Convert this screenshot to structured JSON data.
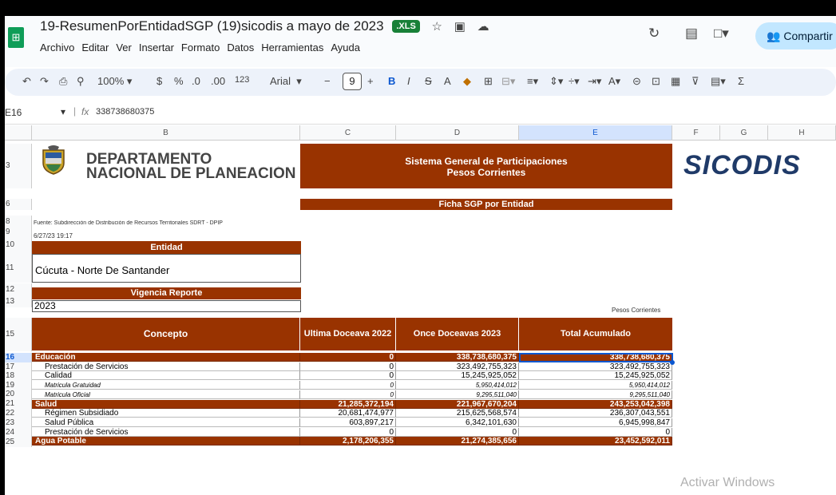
{
  "window": {
    "title": "19-ResumenPorEntidadSGP (19)sicodis a mayo de 2023",
    "badge": ".XLS",
    "share_label": "Compartir"
  },
  "menu": [
    "Archivo",
    "Editar",
    "Ver",
    "Insertar",
    "Formato",
    "Datos",
    "Herramientas",
    "Ayuda"
  ],
  "toolbar": {
    "zoom": "100%",
    "currency": "$",
    "percent": "%",
    "dec_minus": ".0",
    "dec_plus": ".00",
    "number_format": "123",
    "font": "Arial",
    "font_size": "9",
    "bold": "B",
    "italic": "I",
    "strike": "S",
    "text_color": "A",
    "sigma": "Σ"
  },
  "formula_bar": {
    "cell_ref": "E16",
    "fx": "fx",
    "value": "338738680375"
  },
  "columns": [
    "B",
    "C",
    "D",
    "E",
    "F",
    "G",
    "H"
  ],
  "rows": [
    "3",
    "6",
    "8",
    "9",
    "10",
    "11",
    "12",
    "13",
    "15",
    "16",
    "17",
    "18",
    "19",
    "20",
    "21",
    "22",
    "23",
    "24",
    "25"
  ],
  "sheet": {
    "dnp_line1": "DEPARTAMENTO",
    "dnp_line2": "NACIONAL DE PLANEACIÓN",
    "sgp_line1": "Sistema General de Participaciones",
    "sgp_line2": "Pesos Corrientes",
    "ficha": "Ficha SGP por Entidad",
    "sicodis_logo": "SICODIS",
    "fuente": "Fuente: Subdirección de Distribución de Recursos Territoriales SDRT - DPIP",
    "fecha": "6/27/23 19:17",
    "entidad_label": "Entidad",
    "entidad_value": "Cúcuta - Norte De Santander",
    "vigencia_label": "Vigencia Reporte",
    "vigencia_value": "2023",
    "pesos_corrientes": "Pesos Corrientes"
  },
  "table": {
    "headers": [
      "Concepto",
      "Ultima Doceava 2022",
      "Once Doceavas 2023",
      "Total Acumulado"
    ],
    "rows": [
      {
        "c": [
          "Educación",
          "0",
          "338,738,680,375",
          "338,738,680,375"
        ],
        "k": "brn"
      },
      {
        "c": [
          "Prestación de Servicios",
          "0",
          "323,492,755,323",
          "323,492,755,323"
        ],
        "k": "ind"
      },
      {
        "c": [
          "Calidad",
          "0",
          "15,245,925,052",
          "15,245,925,052"
        ],
        "k": "ind"
      },
      {
        "c": [
          "Matricula Gratuidad",
          "0",
          "5,950,414,012",
          "5,950,414,012"
        ],
        "k": "sm"
      },
      {
        "c": [
          "Matricula Oficial",
          "0",
          "9,295,511,040",
          "9,295,511,040"
        ],
        "k": "sm"
      },
      {
        "c": [
          "Salud",
          "21,285,372,194",
          "221,967,670,204",
          "243,253,042,398"
        ],
        "k": "brn"
      },
      {
        "c": [
          "Régimen Subsidiado",
          "20,681,474,977",
          "215,625,568,574",
          "236,307,043,551"
        ],
        "k": "ind"
      },
      {
        "c": [
          "Salud Pública",
          "603,897,217",
          "6,342,101,630",
          "6,945,998,847"
        ],
        "k": "ind"
      },
      {
        "c": [
          "Prestación de Servicios",
          "0",
          "0",
          "0"
        ],
        "k": "ind"
      },
      {
        "c": [
          "Agua Potable",
          "2,178,206,355",
          "21,274,385,656",
          "23,452,592,011"
        ],
        "k": "brn"
      }
    ]
  },
  "watermark": "Activar Windows",
  "colors": {
    "header_brown": "#993300",
    "selection_blue": "#0b57d0",
    "share_bg": "#c2e7ff"
  }
}
